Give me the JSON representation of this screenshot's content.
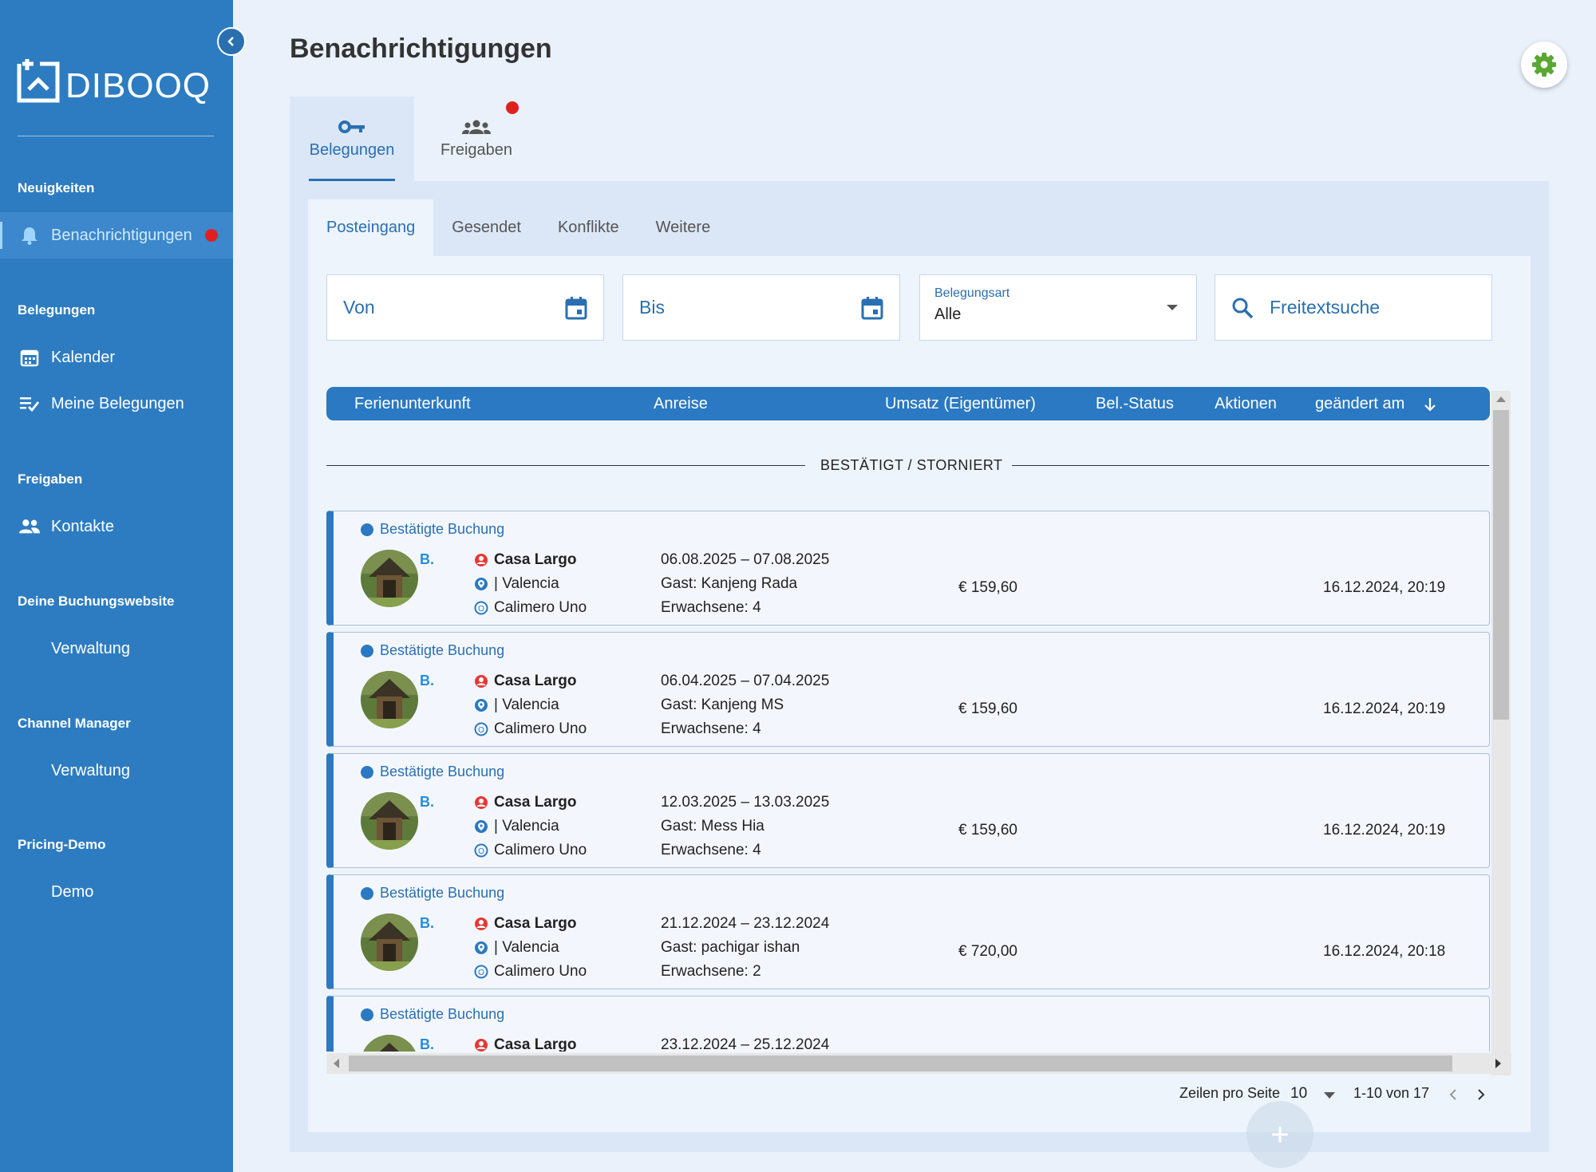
{
  "brand": {
    "logo_text": "DIBOOQ"
  },
  "sidebar": {
    "sections": [
      {
        "title": "Neuigkeiten",
        "items": [
          {
            "label": "Benachrichtigungen",
            "icon": "bell-icon",
            "active": true,
            "badge": true
          }
        ]
      },
      {
        "title": "Belegungen",
        "items": [
          {
            "label": "Kalender",
            "icon": "calendar-icon"
          },
          {
            "label": "Meine Belegungen",
            "icon": "playlist-check-icon"
          }
        ]
      },
      {
        "title": "Freigaben",
        "items": [
          {
            "label": "Kontakte",
            "icon": "people-icon"
          }
        ]
      },
      {
        "title": "Deine Buchungswebsite",
        "items": [
          {
            "label": "Verwaltung"
          }
        ]
      },
      {
        "title": "Channel Manager",
        "items": [
          {
            "label": "Verwaltung"
          }
        ]
      },
      {
        "title": "Pricing-Demo",
        "items": [
          {
            "label": "Demo"
          }
        ]
      }
    ]
  },
  "page": {
    "title": "Benachrichtigungen"
  },
  "main_tabs": [
    {
      "label": "Belegungen",
      "icon": "key-icon",
      "active": true
    },
    {
      "label": "Freigaben",
      "icon": "group-icon",
      "badge": true
    }
  ],
  "sub_tabs": [
    {
      "label": "Posteingang",
      "active": true
    },
    {
      "label": "Gesendet"
    },
    {
      "label": "Konflikte"
    },
    {
      "label": "Weitere"
    }
  ],
  "filters": {
    "from": {
      "placeholder": "Von",
      "icon": "calendar-icon"
    },
    "to": {
      "placeholder": "Bis",
      "icon": "calendar-icon"
    },
    "type": {
      "label": "Belegungsart",
      "value": "Alle"
    },
    "search": {
      "placeholder": "Freitextsuche",
      "icon": "search-icon"
    }
  },
  "table": {
    "columns": [
      "Ferienunterkunft",
      "Anreise",
      "Umsatz (Eigentümer)",
      "Bel.-Status",
      "Aktionen",
      "geändert am"
    ],
    "group_label": "BESTÄTIGT / STORNIERT",
    "rows": [
      {
        "status": "Bestätigte Buchung",
        "brand": "B.",
        "property": "Casa Largo",
        "location": "| Valencia",
        "owner": "Calimero Uno",
        "dates": "06.08.2025 – 07.08.2025",
        "guest": "Gast: Kanjeng Rada",
        "adults": "Erwachsene: 4",
        "amount": "€ 159,60",
        "changed": "16.12.2024, 20:19"
      },
      {
        "status": "Bestätigte Buchung",
        "brand": "B.",
        "property": "Casa Largo",
        "location": "| Valencia",
        "owner": "Calimero Uno",
        "dates": "06.04.2025 – 07.04.2025",
        "guest": "Gast: Kanjeng MS",
        "adults": "Erwachsene: 4",
        "amount": "€ 159,60",
        "changed": "16.12.2024, 20:19"
      },
      {
        "status": "Bestätigte Buchung",
        "brand": "B.",
        "property": "Casa Largo",
        "location": "| Valencia",
        "owner": "Calimero Uno",
        "dates": "12.03.2025 – 13.03.2025",
        "guest": "Gast: Mess Hia",
        "adults": "Erwachsene: 4",
        "amount": "€ 159,60",
        "changed": "16.12.2024, 20:19"
      },
      {
        "status": "Bestätigte Buchung",
        "brand": "B.",
        "property": "Casa Largo",
        "location": "| Valencia",
        "owner": "Calimero Uno",
        "dates": "21.12.2024 – 23.12.2024",
        "guest": "Gast: pachigar ishan",
        "adults": "Erwachsene: 2",
        "amount": "€ 720,00",
        "changed": "16.12.2024, 20:18"
      },
      {
        "status": "Bestätigte Buchung",
        "brand": "B.",
        "property": "Casa Largo",
        "location": "",
        "owner": "",
        "dates": "23.12.2024 – 25.12.2024",
        "guest": "",
        "adults": "",
        "amount": "",
        "changed": ""
      }
    ]
  },
  "pagination": {
    "rows_label": "Zeilen pro Seite",
    "rows_value": "10",
    "range": "1-10 von 17"
  },
  "colors": {
    "sidebar": "#2d7cc1",
    "accent": "#2a6fb2",
    "badge": "#e02020",
    "settings_icon": "#5aa832",
    "owner_icon": "#e53935"
  }
}
